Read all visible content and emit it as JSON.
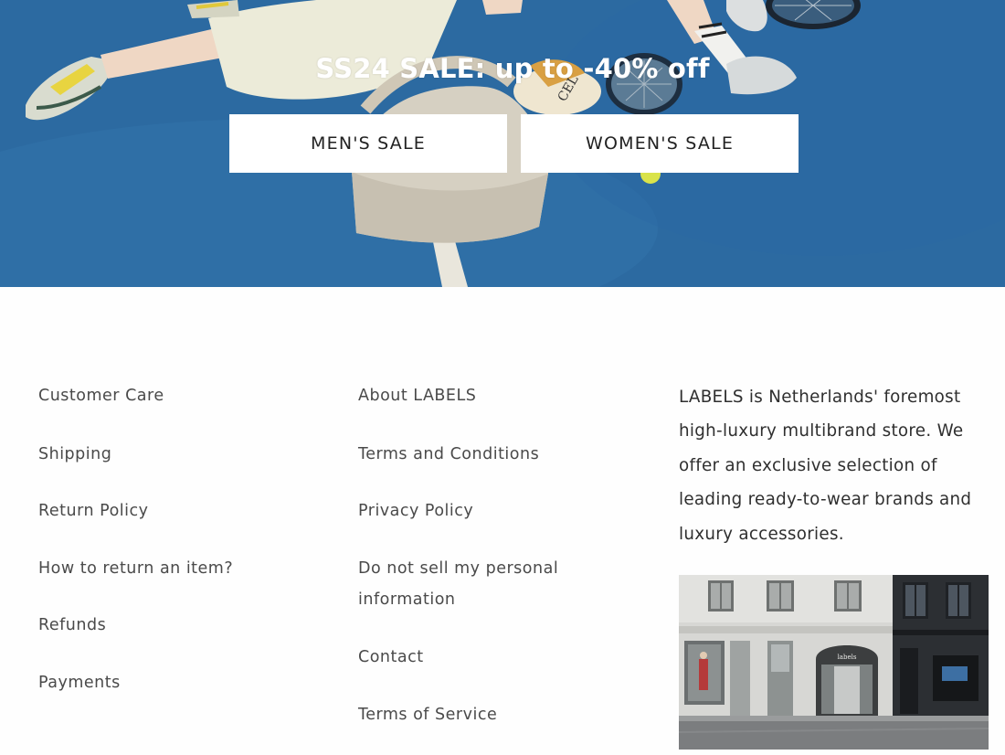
{
  "hero": {
    "title": "SS24 SALE: up to -40% off",
    "buttons": {
      "men": "MEN'S SALE",
      "women": "WOMEN'S SALE"
    }
  },
  "footer": {
    "column1": [
      "Customer Care",
      "Shipping",
      "Return Policy",
      "How to return an item?",
      "Refunds",
      "Payments"
    ],
    "column2": [
      "About LABELS",
      "Terms and Conditions",
      "Privacy Policy",
      "Do not sell my personal information",
      "Contact",
      "Terms of Service"
    ],
    "about": "LABELS is Netherlands' foremost high-luxury multibrand store. We offer an exclusive selection of leading ready-to-wear brands and luxury accessories.",
    "store_sign": "labels"
  }
}
